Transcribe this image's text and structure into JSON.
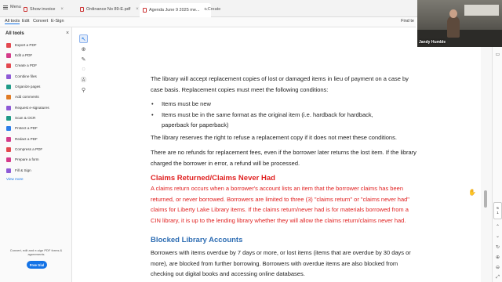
{
  "tabbar": {
    "menu_label": "Menu",
    "tabs": [
      {
        "label": "Show invoice"
      },
      {
        "label": "Ordinance No 89-E.pdf"
      },
      {
        "label": "Agenda June 9 2025 me..."
      }
    ],
    "create_label": "+ Create"
  },
  "toolbar": {
    "items": [
      "All tools",
      "Edit",
      "Convert",
      "E-Sign"
    ],
    "right_label": "Find te"
  },
  "left_panel": {
    "title": "All tools",
    "tools": [
      {
        "label": "Export a PDF",
        "icon": "export-pdf-icon"
      },
      {
        "label": "Edit a PDF",
        "icon": "edit-pdf-icon"
      },
      {
        "label": "Create a PDF",
        "icon": "create-pdf-icon"
      },
      {
        "label": "Combine files",
        "icon": "combine-files-icon"
      },
      {
        "label": "Organize pages",
        "icon": "organize-pages-icon"
      },
      {
        "label": "Add comments",
        "icon": "add-comments-icon"
      },
      {
        "label": "Request e-signatures",
        "icon": "request-signatures-icon"
      },
      {
        "label": "Scan & OCR",
        "icon": "scan-ocr-icon"
      },
      {
        "label": "Protect a PDF",
        "icon": "protect-pdf-icon"
      },
      {
        "label": "Redact a PDF",
        "icon": "redact-pdf-icon"
      },
      {
        "label": "Compress a PDF",
        "icon": "compress-pdf-icon"
      },
      {
        "label": "Prepare a form",
        "icon": "prepare-form-icon"
      },
      {
        "label": "Fill & Sign",
        "icon": "fill-sign-icon"
      }
    ],
    "view_more": "View more",
    "promo_text": "Convert, edit and e-sign PDF forms & agreements",
    "trial_button": "Free trial"
  },
  "document": {
    "para1": "The library will accept replacement copies of lost or damaged items in lieu of payment on a case by case basis. Replacement copies must meet the following conditions:",
    "bullets": [
      "Items must be new",
      "Items must be in the same format as the original item (i.e. hardback for hardback, paperback for paperback)"
    ],
    "para2": "The library reserves the right to refuse a replacement copy if it does not meet these conditions.",
    "para3": "There are no refunds for replacement fees, even if the borrower later returns the lost item. If the library charged the borrower in error, a refund will be processed.",
    "heading_claims": "Claims Returned/Claims Never Had",
    "para_claims": "A claims return occurs when a borrower's account lists an item that the borrower claims has been returned,  or never borrowed. Borrowers are limited to three (3) \"claims return\" or \"claims never had\" claims for Liberty Lake Library items. If the claims return/never had is for materials borrowed from a CIN library, it is up to the lending library whether they will allow the claims return/claims never had.",
    "heading_blocked": "Blocked Library Accounts",
    "para_blocked": "Borrowers with items overdue by 7 days or more, or lost items (items that are overdue by 30 days or more), are blocked from further borrowing. Borrowers with overdue items are also blocked from checking out digital books and accessing online databases."
  },
  "page_indicator": {
    "current": "5",
    "total": "1"
  },
  "webcam": {
    "name_label": "Jandy Humble"
  },
  "colors": {
    "accent": "#1473e6",
    "heading_red": "#e02020",
    "heading_blue": "#2e6db3"
  }
}
